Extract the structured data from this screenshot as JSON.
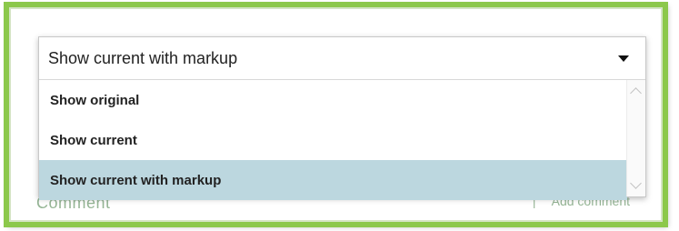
{
  "dropdown": {
    "selected_value": "Show current with markup",
    "options": [
      {
        "label": "Show original"
      },
      {
        "label": "Show current"
      },
      {
        "label": "Show current with markup"
      }
    ],
    "selected_index": 2
  },
  "background": {
    "partial_heading": "Comment",
    "link_separator": "|",
    "link_label": "Add comment"
  },
  "colors": {
    "frame_border": "#8cc84b",
    "selected_option_bg": "#bcd7df"
  },
  "icons": {
    "caret": "caret-down-icon",
    "scroll_up": "chevron-up-icon",
    "scroll_down": "chevron-down-icon"
  }
}
